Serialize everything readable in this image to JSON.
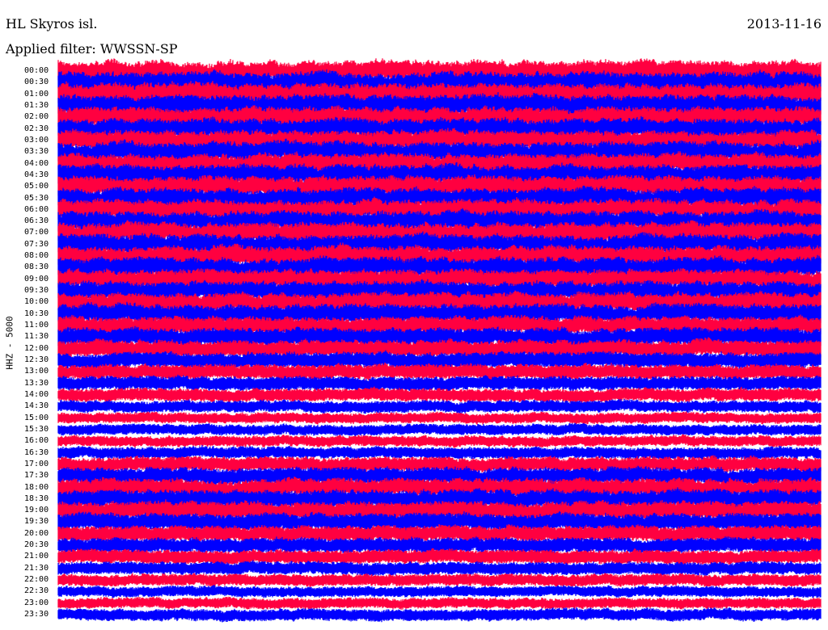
{
  "chart_data": {
    "type": "line",
    "title": "HL Skyros isl.",
    "date": "2013-11-16",
    "subtitle": "Applied filter: WWSSN-SP",
    "ylabel": "HHZ - 5000",
    "row_labels": [
      "00:00",
      "00:30",
      "01:00",
      "01:30",
      "02:00",
      "02:30",
      "03:00",
      "03:30",
      "04:00",
      "04:30",
      "05:00",
      "05:30",
      "06:00",
      "06:30",
      "07:00",
      "07:30",
      "08:00",
      "08:30",
      "09:00",
      "09:30",
      "10:00",
      "10:30",
      "11:00",
      "11:30",
      "12:00",
      "12:30",
      "13:00",
      "13:30",
      "14:00",
      "14:30",
      "15:00",
      "15:30",
      "16:00",
      "16:30",
      "17:00",
      "17:30",
      "18:00",
      "18:30",
      "19:00",
      "19:30",
      "20:00",
      "20:30",
      "21:00",
      "21:30",
      "22:00",
      "22:30",
      "23:00",
      "23:30"
    ],
    "series_colors": [
      "#ff0040",
      "#0000ff"
    ],
    "relative_amplitude": [
      1.0,
      1.0,
      1.0,
      1.0,
      0.95,
      0.95,
      0.95,
      0.95,
      0.95,
      0.95,
      0.95,
      0.95,
      0.95,
      0.95,
      0.95,
      0.95,
      0.95,
      0.95,
      0.9,
      0.9,
      0.9,
      0.9,
      0.85,
      0.85,
      0.8,
      0.75,
      0.7,
      0.65,
      0.6,
      0.55,
      0.5,
      0.5,
      0.5,
      0.55,
      0.7,
      0.8,
      0.85,
      0.85,
      0.85,
      0.8,
      0.75,
      0.7,
      0.65,
      0.6,
      0.55,
      0.5,
      0.5,
      0.55
    ],
    "grid": false
  }
}
